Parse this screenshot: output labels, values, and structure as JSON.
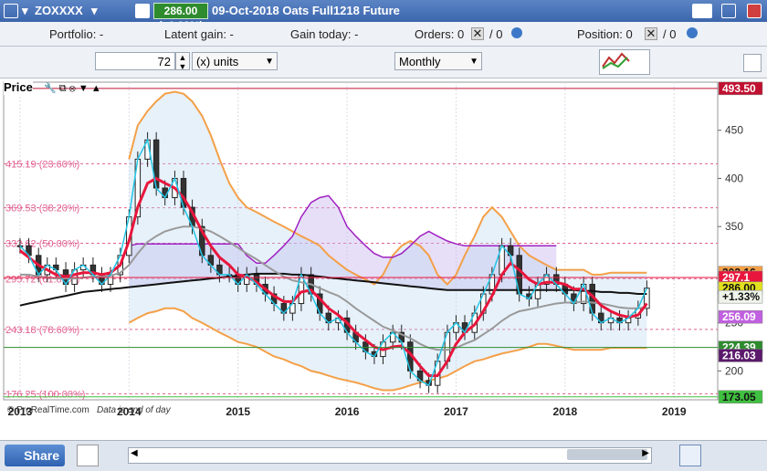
{
  "window": {
    "symbol": "ZOXXXX",
    "price_badge": "286.00 (+1.33%)",
    "title": "09-Oct-2018 Oats Full1218 Future"
  },
  "info_bar": {
    "portfolio": "Portfolio: -",
    "latent_gain": "Latent gain: -",
    "gain_today": "Gain today: -",
    "orders_label": "Orders: 0",
    "orders_count": "/ 0",
    "position_label": "Position: 0",
    "position_count": "/ 0"
  },
  "toolbar": {
    "units_value": "72",
    "units_select": "(x) units",
    "period_select": "Monthly"
  },
  "panel": {
    "label": "Price",
    "copyright": "© ProRealTime.com",
    "note": "Data is end of day"
  },
  "colors": {
    "red_ma": "#e8163c",
    "green_line": "#1fbf1f",
    "maroon": "#8b1010",
    "gray_ma": "#999999",
    "black_ma": "#111111",
    "blue_ma": "#1a3de0",
    "cyan": "#22c6e6",
    "orange_band": "#f4a048",
    "purple": "#a020c0",
    "kijun": "#5b1a6b",
    "sar": "#e07878",
    "sar_green": "#40c040",
    "fib": "#e06090"
  },
  "chart_data": {
    "type": "line",
    "title": "Oats Full1218 Future - Monthly",
    "x_ticks": [
      "2013",
      "2014",
      "2015",
      "2016",
      "2017",
      "2018",
      "2019"
    ],
    "y_ticks": [
      200,
      250,
      300,
      350,
      400,
      450
    ],
    "ylim": [
      170,
      500
    ],
    "last_price": 286.0,
    "change_pct": "+1.33%",
    "price_tags": [
      {
        "label": "493.50",
        "value": 493.5,
        "color": "#c01030"
      },
      {
        "label": "302.16",
        "value": 302.16,
        "color": "#f4a048"
      },
      {
        "label": "297.1",
        "value": 297.1,
        "color": "#e8163c"
      },
      {
        "label": "286.00",
        "value": 286.0,
        "color": "#e0e020"
      },
      {
        "label": "+1.33%",
        "value": 277,
        "color": "#eef4ea"
      },
      {
        "label": "256.09",
        "value": 256.09,
        "color": "#c060e0"
      },
      {
        "label": "224.39",
        "value": 224.39,
        "color": "#2e8b2e"
      },
      {
        "label": "216.03",
        "value": 216.03,
        "color": "#5b1a6b"
      },
      {
        "label": "173.05",
        "value": 173.05,
        "color": "#40c040"
      }
    ],
    "fib_levels": [
      {
        "label": "415.19 (23.60%)",
        "value": 415.19
      },
      {
        "label": "369.53 (38.20%)",
        "value": 369.53
      },
      {
        "label": "332.62 (50.00%)",
        "value": 332.62
      },
      {
        "label": "295.72 (61.80%)",
        "value": 295.72
      },
      {
        "label": "243.18 (78.60%)",
        "value": 243.18
      },
      {
        "label": "176.25 (100.00%)",
        "value": 176.25
      }
    ],
    "candles_month": [
      2013.0,
      2013.08,
      2013.17,
      2013.25,
      2013.33,
      2013.42,
      2013.5,
      2013.58,
      2013.67,
      2013.75,
      2013.83,
      2013.92,
      2014.0,
      2014.08,
      2014.17,
      2014.25,
      2014.33,
      2014.42,
      2014.5,
      2014.58,
      2014.67,
      2014.75,
      2014.83,
      2014.92,
      2015.0,
      2015.08,
      2015.17,
      2015.25,
      2015.33,
      2015.42,
      2015.5,
      2015.58,
      2015.67,
      2015.75,
      2015.83,
      2015.92,
      2016.0,
      2016.08,
      2016.17,
      2016.25,
      2016.33,
      2016.42,
      2016.5,
      2016.58,
      2016.67,
      2016.75,
      2016.83,
      2016.92,
      2017.0,
      2017.08,
      2017.17,
      2017.25,
      2017.33,
      2017.42,
      2017.5,
      2017.58,
      2017.67,
      2017.75,
      2017.83,
      2017.92,
      2018.0,
      2018.08,
      2018.17,
      2018.25,
      2018.33,
      2018.42,
      2018.5,
      2018.58,
      2018.67,
      2018.75
    ],
    "close": [
      330,
      320,
      300,
      310,
      305,
      290,
      305,
      310,
      300,
      290,
      300,
      320,
      360,
      420,
      440,
      390,
      380,
      400,
      370,
      350,
      320,
      310,
      300,
      300,
      290,
      300,
      290,
      280,
      270,
      260,
      270,
      300,
      280,
      260,
      250,
      255,
      240,
      230,
      220,
      215,
      230,
      240,
      230,
      200,
      190,
      185,
      210,
      240,
      250,
      240,
      260,
      280,
      300,
      330,
      320,
      280,
      275,
      290,
      300,
      290,
      280,
      270,
      290,
      260,
      250,
      255,
      250,
      255,
      265,
      286
    ],
    "series": [
      {
        "name": "sma_fast",
        "values": [
          325,
          318,
          310,
          305,
          300,
          298,
          300,
          302,
          302,
          300,
          302,
          310,
          335,
          370,
          395,
          400,
          395,
          390,
          380,
          365,
          345,
          330,
          318,
          310,
          300,
          298,
          292,
          285,
          278,
          272,
          272,
          282,
          284,
          275,
          265,
          258,
          250,
          240,
          232,
          225,
          222,
          225,
          226,
          218,
          205,
          195,
          195,
          210,
          228,
          240,
          248,
          262,
          278,
          300,
          312,
          305,
          295,
          290,
          292,
          292,
          290,
          285,
          285,
          278,
          268,
          262,
          258,
          256,
          258,
          270
        ]
      },
      {
        "name": "sma_slow",
        "values": [
          300,
          300,
          298,
          297,
          296,
          296,
          296,
          297,
          298,
          298,
          299,
          302,
          310,
          322,
          334,
          340,
          345,
          348,
          350,
          350,
          348,
          345,
          340,
          334,
          328,
          322,
          316,
          310,
          304,
          298,
          294,
          292,
          290,
          286,
          282,
          278,
          272,
          265,
          258,
          252,
          246,
          242,
          238,
          234,
          228,
          224,
          222,
          222,
          224,
          228,
          232,
          238,
          244,
          252,
          258,
          262,
          264,
          266,
          268,
          270,
          271,
          271,
          272,
          271,
          270,
          268,
          266,
          265,
          265,
          266
        ]
      },
      {
        "name": "long_ma",
        "values": [
          268,
          270,
          272,
          274,
          276,
          278,
          280,
          282,
          283,
          284,
          285,
          286,
          287,
          288,
          289,
          290,
          291,
          292,
          293,
          294,
          295,
          296,
          297,
          298,
          299,
          300,
          301,
          301,
          301,
          301,
          300,
          300,
          299,
          298,
          297,
          296,
          295,
          294,
          293,
          292,
          291,
          290,
          289,
          288,
          287,
          286,
          285,
          284,
          284,
          284,
          284,
          284,
          284,
          284,
          284,
          284,
          284,
          284,
          284,
          284,
          284,
          284,
          283,
          283,
          282,
          282,
          281,
          281,
          280,
          280
        ]
      },
      {
        "name": "upper_band",
        "values": [
          null,
          null,
          null,
          null,
          null,
          null,
          null,
          null,
          null,
          null,
          null,
          null,
          420,
          455,
          470,
          480,
          488,
          490,
          488,
          480,
          465,
          445,
          420,
          395,
          380,
          370,
          365,
          360,
          355,
          350,
          345,
          340,
          335,
          330,
          320,
          312,
          305,
          300,
          295,
          290,
          300,
          320,
          330,
          335,
          330,
          320,
          300,
          290,
          300,
          320,
          340,
          360,
          370,
          360,
          345,
          330,
          320,
          315,
          310,
          305,
          305,
          305,
          305,
          300,
          300,
          302,
          302,
          302,
          302,
          302
        ]
      },
      {
        "name": "lower_band",
        "values": [
          null,
          null,
          null,
          null,
          null,
          null,
          null,
          null,
          null,
          null,
          null,
          null,
          250,
          255,
          260,
          262,
          265,
          265,
          262,
          255,
          250,
          245,
          240,
          235,
          230,
          228,
          225,
          220,
          215,
          212,
          208,
          205,
          200,
          198,
          195,
          192,
          190,
          188,
          185,
          182,
          180,
          180,
          182,
          185,
          188,
          190,
          192,
          195,
          200,
          205,
          210,
          212,
          215,
          218,
          220,
          222,
          225,
          228,
          228,
          226,
          224,
          222,
          222,
          222,
          222,
          224,
          224,
          224,
          224,
          224
        ]
      },
      {
        "name": "cloud_top",
        "values": [
          null,
          null,
          null,
          null,
          null,
          null,
          null,
          null,
          null,
          null,
          null,
          null,
          330,
          332,
          332,
          332,
          332,
          332,
          332,
          332,
          332,
          332,
          332,
          332,
          332,
          320,
          312,
          312,
          320,
          330,
          340,
          360,
          375,
          380,
          382,
          370,
          350,
          340,
          330,
          322,
          318,
          318,
          322,
          330,
          340,
          345,
          340,
          335,
          332,
          330,
          330,
          330,
          330,
          330,
          330,
          330,
          330,
          330,
          330,
          330
        ]
      }
    ]
  }
}
